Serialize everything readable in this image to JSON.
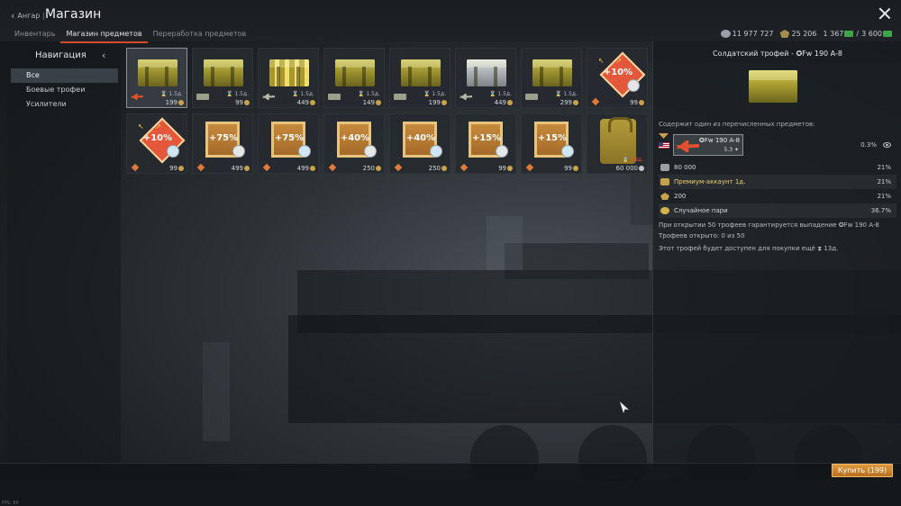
{
  "header": {
    "back_label": "Ангар",
    "title": "Магазин",
    "tabs": [
      {
        "label": "Инвентарь"
      },
      {
        "label": "Магазин предметов",
        "active": true
      },
      {
        "label": "Переработка предметов"
      }
    ],
    "currencies": {
      "silver": "11 977 727",
      "eagles": "25 206",
      "research_current": "1 367",
      "research_separator": "/",
      "research_total": "3 600"
    }
  },
  "nav": {
    "title": "Навигация",
    "items": [
      {
        "label": "Все",
        "selected": true
      },
      {
        "label": "Боевые трофеи"
      },
      {
        "label": "Усилители"
      }
    ]
  },
  "shop": {
    "items": [
      {
        "kind": "chest",
        "style": "gold",
        "timer": "1.5д.",
        "price": "199",
        "vehicle": "redplane",
        "selected": true
      },
      {
        "kind": "chest",
        "style": "gold",
        "timer": "1.5д.",
        "price": "99",
        "vehicle": "tank"
      },
      {
        "kind": "chest",
        "style": "striped",
        "timer": "1.5д.",
        "price": "449",
        "vehicle": "plane"
      },
      {
        "kind": "chest",
        "style": "gold",
        "timer": "1.5д.",
        "price": "149",
        "vehicle": "tank"
      },
      {
        "kind": "chest",
        "style": "gold",
        "timer": "1.5д.",
        "price": "199",
        "vehicle": "tank"
      },
      {
        "kind": "chest",
        "style": "silver",
        "timer": "1.5д.",
        "price": "449",
        "vehicle": "plane"
      },
      {
        "kind": "chest",
        "style": "gold",
        "timer": "1.5д.",
        "price": "299",
        "vehicle": "tank"
      },
      {
        "kind": "booster",
        "style": "diamond",
        "pct": "+10%",
        "price": "99",
        "icon": "lion"
      },
      {
        "kind": "booster",
        "style": "diamond",
        "pct": "+10%",
        "price": "99",
        "icon": "bulb"
      },
      {
        "kind": "booster",
        "style": "square",
        "pct": "+75%",
        "price": "499",
        "icon": "lion"
      },
      {
        "kind": "booster",
        "style": "square",
        "pct": "+75%",
        "price": "499",
        "icon": "bulb"
      },
      {
        "kind": "booster",
        "style": "square",
        "pct": "+40%",
        "price": "250",
        "icon": "lion"
      },
      {
        "kind": "booster",
        "style": "square",
        "pct": "+40%",
        "price": "250",
        "icon": "bulb"
      },
      {
        "kind": "booster",
        "style": "square",
        "pct": "+15%",
        "price": "99",
        "icon": "lion"
      },
      {
        "kind": "booster",
        "style": "square",
        "pct": "+15%",
        "price": "99",
        "icon": "bulb"
      },
      {
        "kind": "bag",
        "timer": "28д.",
        "price": "60 000",
        "currency": "silver"
      }
    ]
  },
  "details": {
    "title": "Солдатский трофей - ✪Fw 190 A-8",
    "contains_label": "Содержит один из перечисленных предметов:",
    "vehicle": {
      "name": "✪Fw 190 A-8",
      "br": "5.3 ✦",
      "chance": "0.3%"
    },
    "drops": [
      {
        "label": "80 000",
        "chance": "21%",
        "icon": "silver"
      },
      {
        "label": "Премиум-аккаунт 1д.",
        "chance": "21%",
        "icon": "prem"
      },
      {
        "label": "200",
        "chance": "21%",
        "icon": "gold"
      },
      {
        "label": "Случайное пари",
        "chance": "36.7%",
        "icon": "medal"
      }
    ],
    "guarantee": "При открытии 50 трофеев гарантируется выпадение ✪Fw 190 A-8",
    "opened": "Трофеев открыто: 0 из 50",
    "available": "Этот трофей будет доступен для покупки ещё ⧗ 13д."
  },
  "footer": {
    "buy_label": "Купить (199)",
    "fps": "FPS: 60"
  },
  "colors": {
    "accent": "#d84b2a",
    "buy": "#d98a2e",
    "premium_text": "#f0d070"
  }
}
